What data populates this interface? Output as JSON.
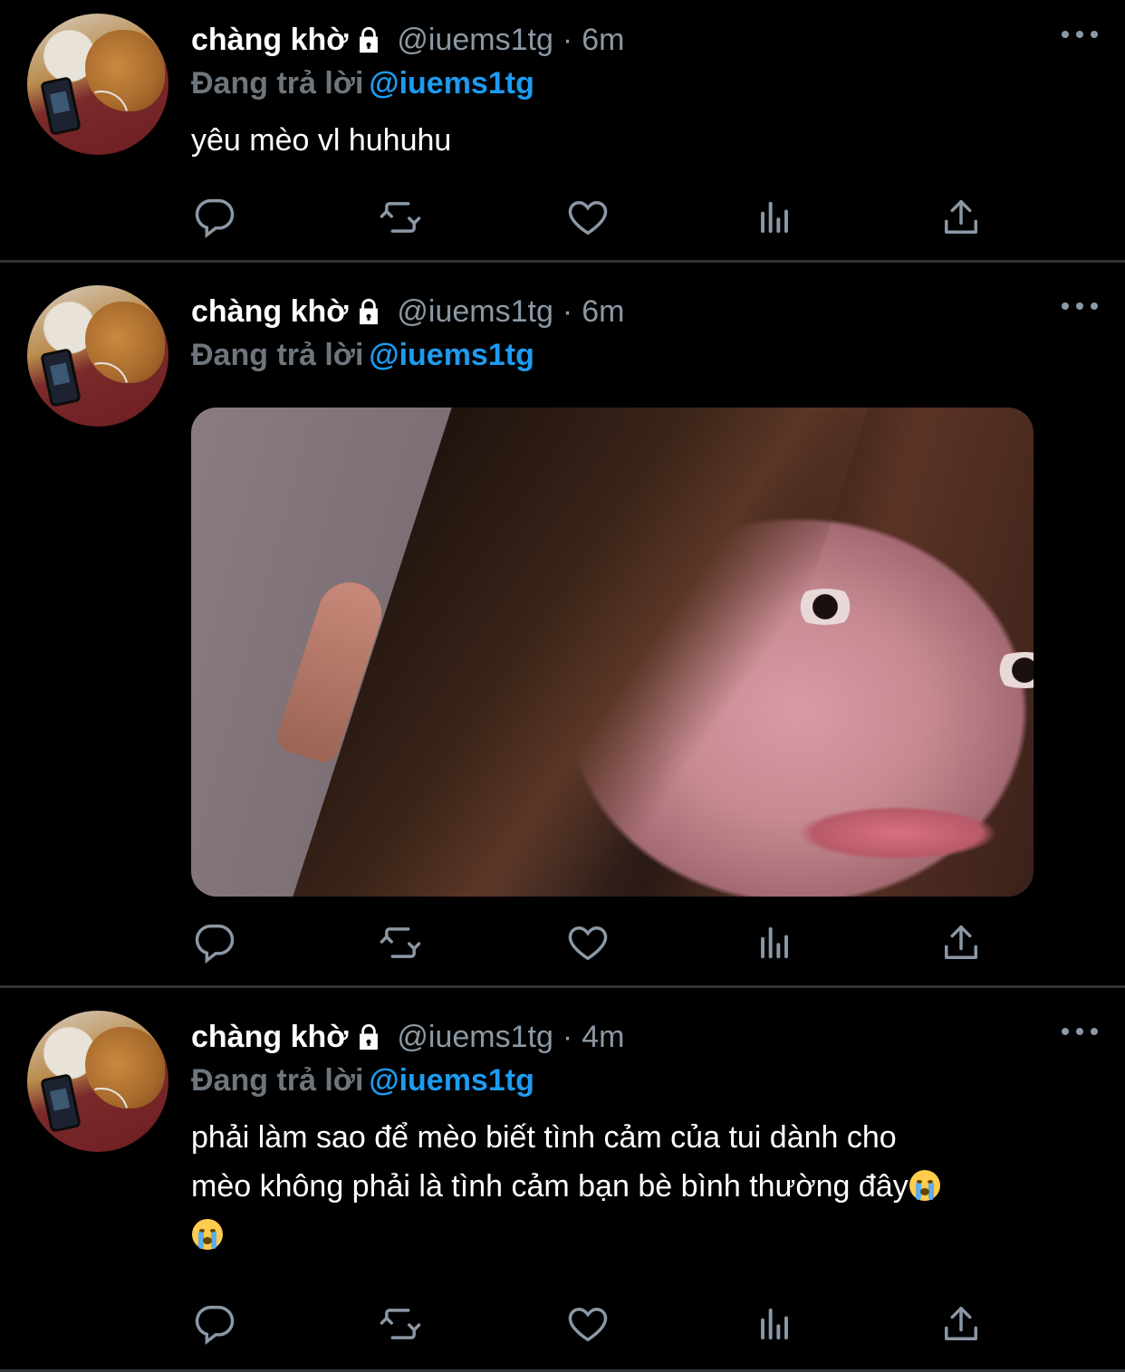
{
  "tweets": [
    {
      "display_name": "chàng khờ",
      "handle": "@iuems1tg",
      "separator": "·",
      "time": "6m",
      "replying_label": "Đang trả lời",
      "replying_to": "@iuems1tg",
      "text": "yêu mèo vl huhuhu",
      "has_media": false
    },
    {
      "display_name": "chàng khờ",
      "handle": "@iuems1tg",
      "separator": "·",
      "time": "6m",
      "replying_label": "Đang trả lời",
      "replying_to": "@iuems1tg",
      "text": "",
      "has_media": true
    },
    {
      "display_name": "chàng khờ",
      "handle": "@iuems1tg",
      "separator": "·",
      "time": "4m",
      "replying_label": "Đang trả lời",
      "replying_to": "@iuems1tg",
      "text_line1": "phải làm sao để mèo biết tình cảm của tui dành cho",
      "text_line2": "mèo không phải là tình cảm bạn bè bình thường đây",
      "has_media": false
    }
  ],
  "icons": {
    "lock": "lock-icon",
    "more": "more-horizontal-icon",
    "reply": "reply-icon",
    "retweet": "retweet-icon",
    "like": "heart-icon",
    "analytics": "analytics-icon",
    "share": "share-icon",
    "emoji": "loudly-crying-face-emoji"
  },
  "colors": {
    "background": "#000000",
    "name": "#ffffff",
    "muted": "#8b98a5",
    "mention": "#1d9bf0",
    "divider": "#2f3336",
    "icon": "#8b98a5"
  }
}
